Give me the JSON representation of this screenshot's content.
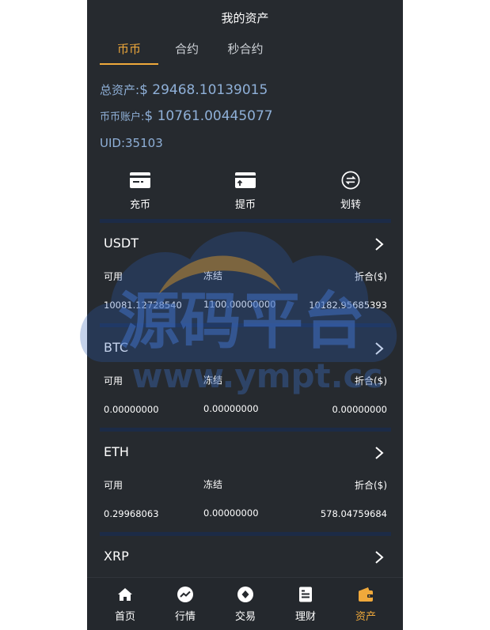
{
  "header": {
    "title": "我的资产"
  },
  "tabs": [
    {
      "label": "币币",
      "active": true
    },
    {
      "label": "合约",
      "active": false
    },
    {
      "label": "秒合约",
      "active": false
    }
  ],
  "summary": {
    "total_label": "总资产:",
    "total_value": "$ 29468.10139015",
    "account_label": "币币账户:",
    "account_value": "$ 10761.00445077",
    "uid_label": "UID:",
    "uid_value": "35103"
  },
  "actions": [
    {
      "label": "充币",
      "icon": "deposit-card-icon"
    },
    {
      "label": "提币",
      "icon": "withdraw-card-icon"
    },
    {
      "label": "划转",
      "icon": "transfer-icon"
    }
  ],
  "columns": {
    "available": "可用",
    "frozen": "冻结",
    "converted": "折合($)"
  },
  "coins": [
    {
      "name": "USDT",
      "available": "10081.12728540",
      "frozen": "1100.00000000",
      "converted": "10182.95685393"
    },
    {
      "name": "BTC",
      "available": "0.00000000",
      "frozen": "0.00000000",
      "converted": "0.00000000"
    },
    {
      "name": "ETH",
      "available": "0.29968063",
      "frozen": "0.00000000",
      "converted": "578.04759684"
    },
    {
      "name": "XRP"
    }
  ],
  "watermark": {
    "text": "源码平台",
    "url_text": "www.ympt.cc"
  },
  "nav": [
    {
      "label": "首页",
      "icon": "home-icon",
      "active": false
    },
    {
      "label": "行情",
      "icon": "market-trend-icon",
      "active": false
    },
    {
      "label": "交易",
      "icon": "trade-icon",
      "active": false
    },
    {
      "label": "理财",
      "icon": "finance-doc-icon",
      "active": false
    },
    {
      "label": "资产",
      "icon": "wallet-icon",
      "active": true
    }
  ],
  "colors": {
    "accent": "#f0a93b",
    "background": "#262a2f",
    "summary_text": "#8fb0d8",
    "divider": "#1c2b47"
  }
}
